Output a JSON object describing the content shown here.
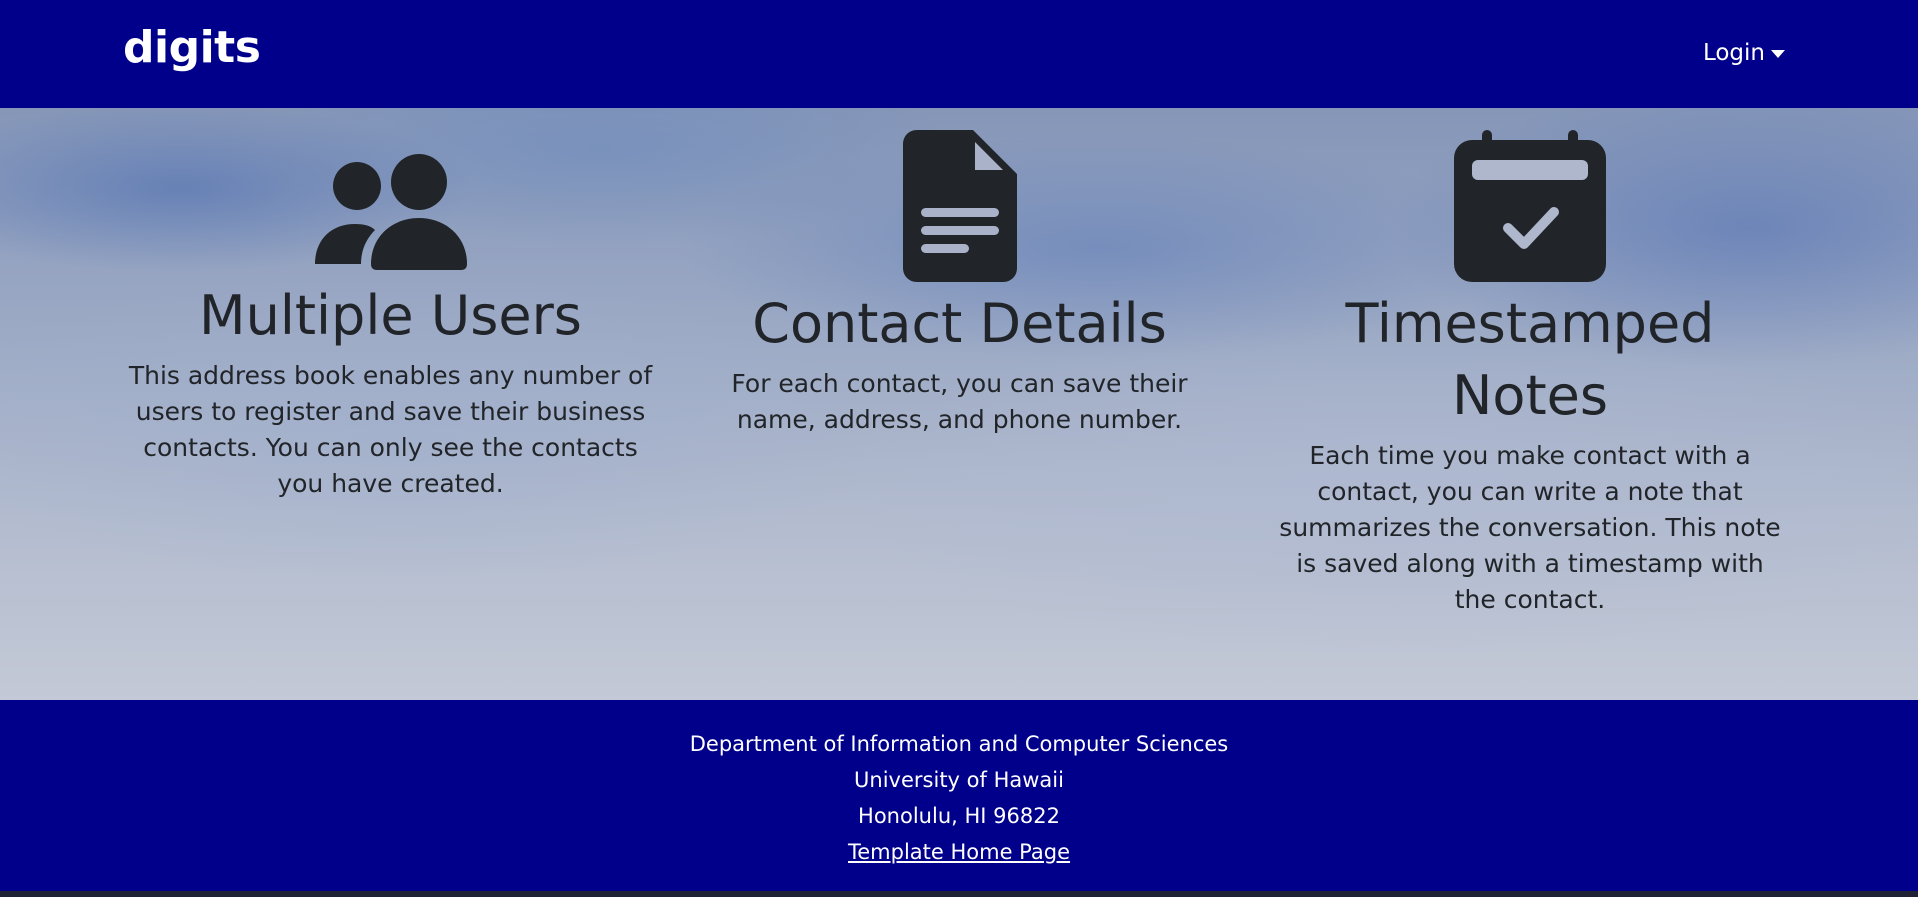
{
  "navbar": {
    "brand": "digits",
    "login_label": "Login"
  },
  "features": [
    {
      "icon": "users-icon",
      "title": "Multiple Users",
      "description": "This address book enables any number of users to register and save their business contacts. You can only see the contacts you have created."
    },
    {
      "icon": "file-text-icon",
      "title": "Contact Details",
      "description": "For each contact, you can save their name, address, and phone number."
    },
    {
      "icon": "calendar-check-icon",
      "title": "Timestamped Notes",
      "description": "Each time you make contact with a contact, you can write a note that summarizes the conversation. This note is saved along with a timestamp with the contact."
    }
  ],
  "footer": {
    "line1": "Department of Information and Computer Sciences",
    "line2": "University of Hawaii",
    "line3": "Honolulu, HI 96822",
    "link_label": "Template Home Page"
  },
  "colors": {
    "navbar_bg": "#00008b",
    "footer_bg": "#00008b",
    "text_dark": "#212529",
    "icon_dark": "#212529"
  }
}
